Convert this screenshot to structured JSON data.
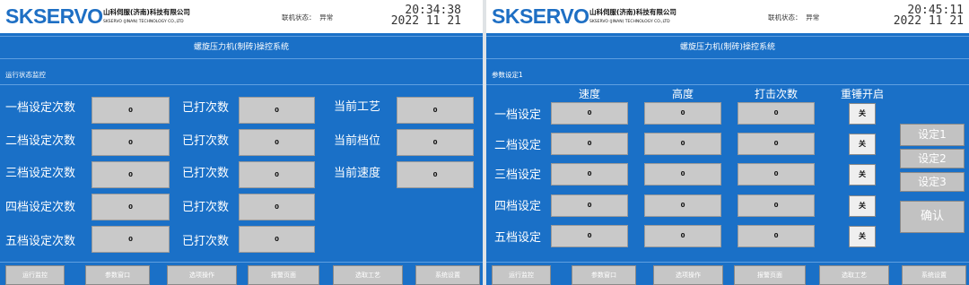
{
  "left": {
    "header": {
      "logo": "SKSERVO",
      "company_cn": "山科伺服(济南)科技有限公司",
      "company_en": "SKSERVO (JINAN) TECHNOLOGY CO.,LTD",
      "status_label": "联机状态：",
      "status_value": "异常",
      "time": "20:34:38",
      "date": "2022 11 21"
    },
    "title": "螺旋压力机(制砖)操控系统",
    "subtitle": "运行状态监控",
    "rows": [
      {
        "label": "一档设定次数",
        "value": "0",
        "hit_label": "已打次数",
        "hit_value": "0"
      },
      {
        "label": "二档设定次数",
        "value": "0",
        "hit_label": "已打次数",
        "hit_value": "0"
      },
      {
        "label": "三档设定次数",
        "value": "0",
        "hit_label": "已打次数",
        "hit_value": "0"
      },
      {
        "label": "四档设定次数",
        "value": "0",
        "hit_label": "已打次数",
        "hit_value": "0"
      },
      {
        "label": "五档设定次数",
        "value": "0",
        "hit_label": "已打次数",
        "hit_value": "0"
      }
    ],
    "status_items": [
      {
        "label": "当前工艺",
        "value": "0"
      },
      {
        "label": "当前档位",
        "value": "0"
      },
      {
        "label": "当前速度",
        "value": "0"
      }
    ],
    "nav": [
      "运行监控",
      "参数窗口",
      "选项操作",
      "报警页面",
      "选取工艺",
      "系统设置"
    ]
  },
  "right": {
    "header": {
      "logo": "SKSERVO",
      "company_cn": "山科伺服(济南)科技有限公司",
      "company_en": "SKSERVO (JINAN) TECHNOLOGY CO.,LTD",
      "status_label": "联机状态：",
      "status_value": "异常",
      "time": "20:45:11",
      "date": "2022 11 21"
    },
    "title": "螺旋压力机(制砖)操控系统",
    "subtitle": "参数设定1",
    "columns": [
      "速度",
      "高度",
      "打击次数",
      "重锤开启"
    ],
    "rows": [
      {
        "label": "一档设定",
        "speed": "0",
        "height": "0",
        "hits": "0",
        "toggle": "关"
      },
      {
        "label": "二档设定",
        "speed": "0",
        "height": "0",
        "hits": "0",
        "toggle": "关"
      },
      {
        "label": "三档设定",
        "speed": "0",
        "height": "0",
        "hits": "0",
        "toggle": "关"
      },
      {
        "label": "四档设定",
        "speed": "0",
        "height": "0",
        "hits": "0",
        "toggle": "关"
      },
      {
        "label": "五档设定",
        "speed": "0",
        "height": "0",
        "hits": "0",
        "toggle": "关"
      }
    ],
    "side_buttons": [
      "设定1",
      "设定2",
      "设定3"
    ],
    "confirm": "确认",
    "nav": [
      "运行监控",
      "参数窗口",
      "选项操作",
      "报警页面",
      "选取工艺",
      "系统设置"
    ]
  }
}
